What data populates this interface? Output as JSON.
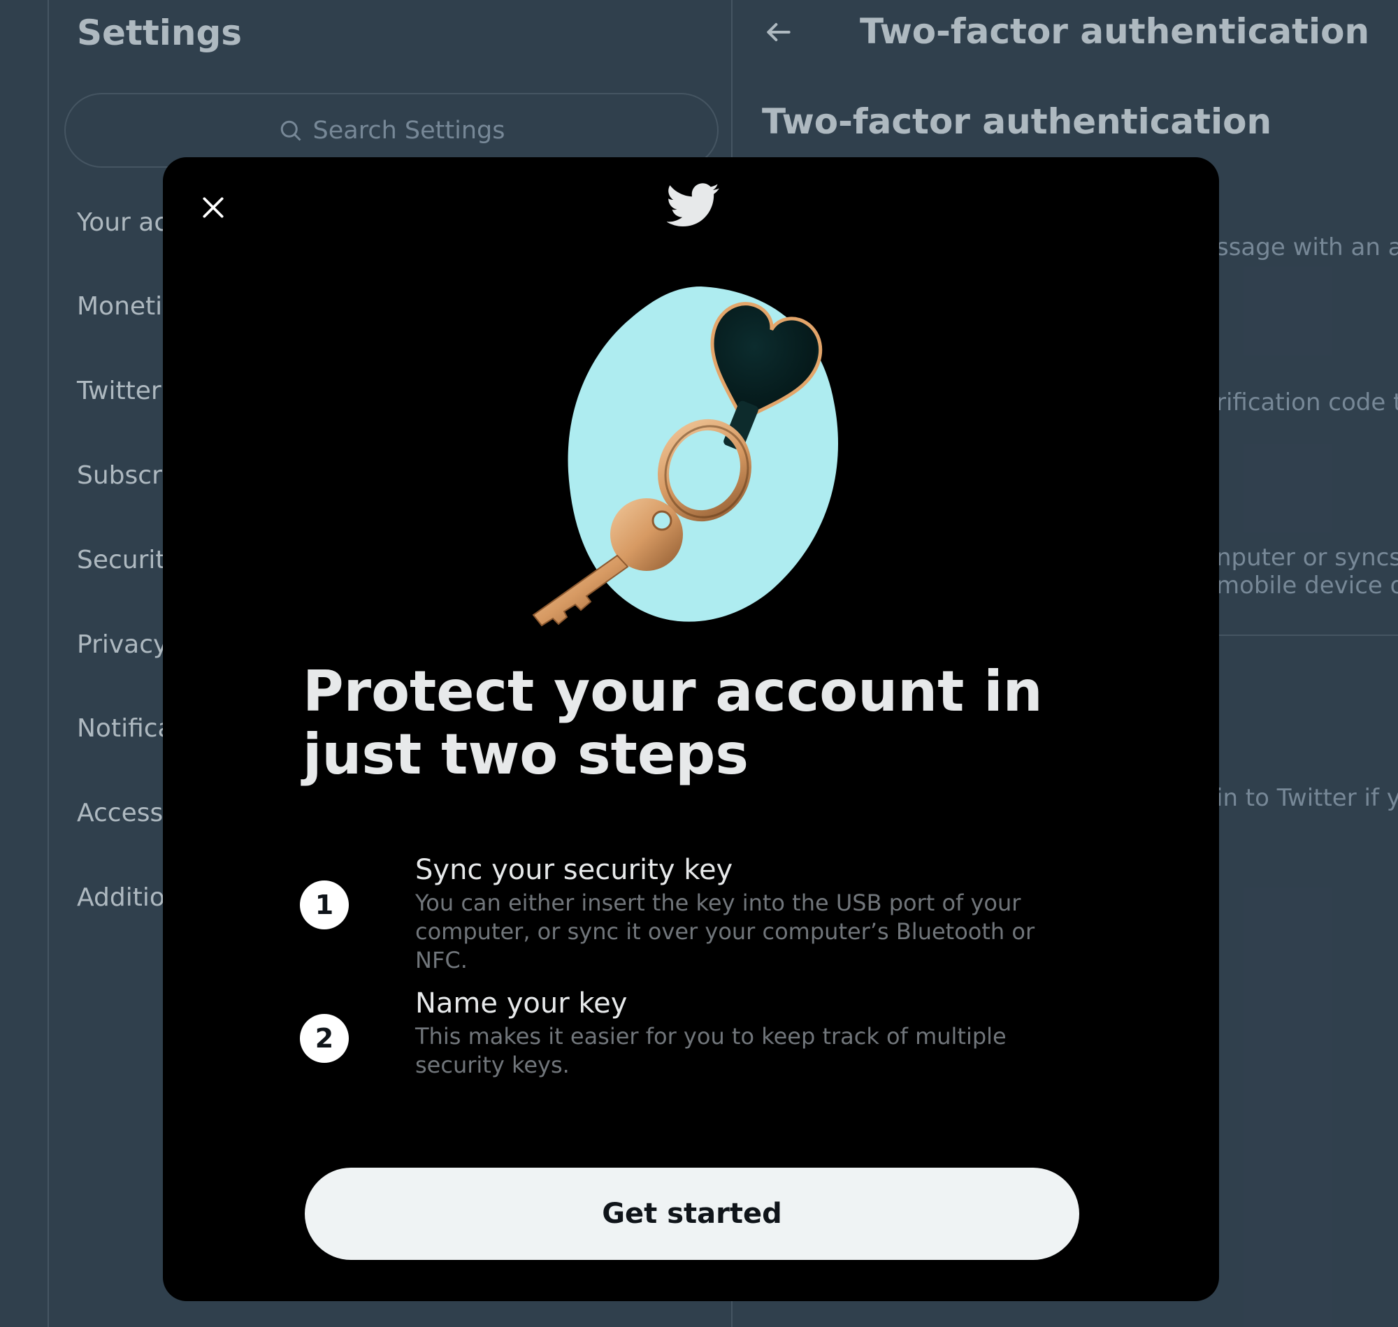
{
  "settings": {
    "title": "Settings",
    "search_placeholder": "Search Settings",
    "menu": [
      {
        "label": "Your account"
      },
      {
        "label": "Monetization"
      },
      {
        "label": "Twitter Blue"
      },
      {
        "label": "Subscriptions"
      },
      {
        "label": "Security and account access"
      },
      {
        "label": "Privacy and safety"
      },
      {
        "label": "Notifications"
      },
      {
        "label": "Accessibility, display, and languages"
      },
      {
        "label": "Additional resources"
      }
    ]
  },
  "detail": {
    "header": "Two-factor authentication",
    "subtitle": "Two-factor authentication",
    "visible_fragments": [
      "ssage with an auth",
      "rification code to",
      "nputer or syncs to",
      "mobile device or w",
      "in to Twitter if yo"
    ]
  },
  "modal": {
    "headline": "Protect your account in just two steps",
    "steps": [
      {
        "number": "1",
        "title": "Sync your security key",
        "description": "You can either insert the key into the USB port of your computer, or sync it over your computer’s Bluetooth or NFC."
      },
      {
        "number": "2",
        "title": "Name your key",
        "description": "This makes it easier for you to keep track of multiple security keys."
      }
    ],
    "cta_label": "Get started"
  },
  "colors": {
    "app_background": "#15202b",
    "modal_background": "#000000",
    "cta_background": "#eff3f4",
    "hero_blob": "#aeecf0",
    "muted_text": "#71767b"
  },
  "icons": [
    "search-icon",
    "back-arrow-icon",
    "close-icon",
    "twitter-bird-icon",
    "security-key-illustration"
  ]
}
